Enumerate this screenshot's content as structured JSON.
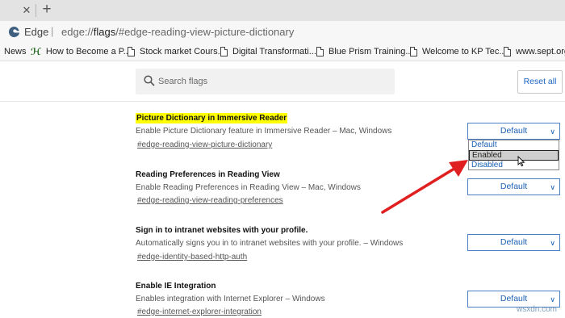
{
  "browser": {
    "tab_close_glyph": "✕",
    "new_tab_glyph": "+",
    "name": "Edge",
    "address_separator": "|",
    "url_prefix": "edge://",
    "url_bold": "flags",
    "url_rest": "/#edge-reading-view-picture-dictionary"
  },
  "bookmarks": [
    {
      "label": "News",
      "icon": "none"
    },
    {
      "label": "How to Become a P...",
      "icon": "site-logo-icon"
    },
    {
      "label": "Stock market Cours...",
      "icon": "page-icon"
    },
    {
      "label": "Digital Transformati...",
      "icon": "page-icon"
    },
    {
      "label": "Blue Prism Training...",
      "icon": "page-icon"
    },
    {
      "label": "Welcome to KP Tec...",
      "icon": "page-icon"
    },
    {
      "label": "www.sept.org/",
      "icon": "page-icon"
    }
  ],
  "search": {
    "placeholder": "Search flags",
    "value": ""
  },
  "reset_button": "Reset all",
  "flags": [
    {
      "title": "Picture Dictionary in Immersive Reader",
      "description": "Enable Picture Dictionary feature in Immersive Reader – Mac, Windows",
      "link": "#edge-reading-view-picture-dictionary",
      "value": "Default",
      "highlighted": true
    },
    {
      "title": "Reading Preferences in Reading View",
      "description": "Enable Reading Preferences in Reading View – Mac, Windows",
      "link": "#edge-reading-view-reading-preferences",
      "value": "Default",
      "highlighted": false
    },
    {
      "title": "Sign in to intranet websites with your profile.",
      "description": "Automatically signs you in to intranet websites with your profile. – Windows",
      "link": "#edge-identity-based-http-auth",
      "value": "Default",
      "highlighted": false
    },
    {
      "title": "Enable IE Integration",
      "description": "Enables integration with Internet Explorer – Windows",
      "link": "#edge-internet-explorer-integration",
      "value": "Default",
      "highlighted": false
    }
  ],
  "dropdown_options": [
    "Default",
    "Enabled",
    "Disabled"
  ],
  "dropdown_hovered": "Enabled",
  "chevron_glyph": "∨",
  "watermark": "wsxdn.com",
  "colors": {
    "accent": "#1a5fb4",
    "highlight": "#ffff00",
    "annotation_arrow": "#e02020"
  }
}
